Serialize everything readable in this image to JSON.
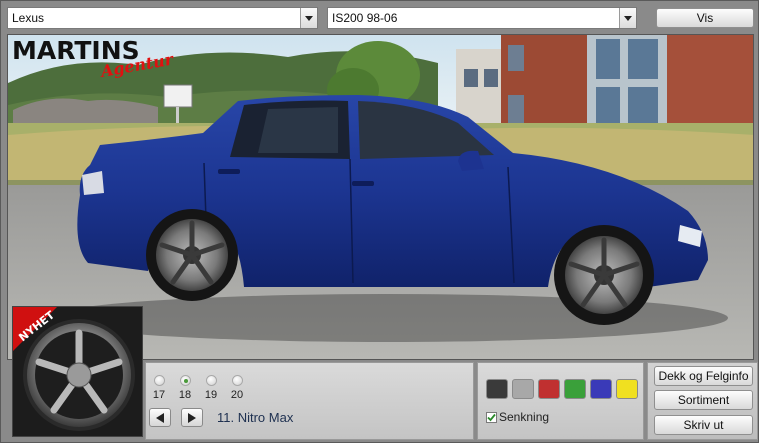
{
  "selectors": {
    "make": "Lexus",
    "model": "IS200 98-06"
  },
  "toolbar": {
    "show_label": "Vis"
  },
  "banner": {
    "brand": "MARTINS",
    "tagline": "Agentur",
    "badge": "NYHET"
  },
  "wheel": {
    "sizes": [
      {
        "label": "17",
        "selected": false
      },
      {
        "label": "18",
        "selected": true
      },
      {
        "label": "19",
        "selected": false
      },
      {
        "label": "20",
        "selected": false
      }
    ],
    "name": "11. Nitro Max"
  },
  "colors": {
    "swatches": [
      {
        "name": "black",
        "hex": "#3a3a3a"
      },
      {
        "name": "grey",
        "hex": "#a8a8a8"
      },
      {
        "name": "red",
        "hex": "#c03030"
      },
      {
        "name": "green",
        "hex": "#3aa03a"
      },
      {
        "name": "blue",
        "hex": "#3a3ab8"
      },
      {
        "name": "yellow",
        "hex": "#f0e020"
      }
    ],
    "lowering_label": "Senkning",
    "lowering_checked": true
  },
  "buttons": {
    "tire_info": "Dekk og Felginfo",
    "assortment": "Sortiment",
    "print": "Skriv ut"
  },
  "icons": {
    "dropdown": "chevron-down-icon",
    "prev": "triangle-left-icon",
    "next": "triangle-right-icon",
    "check": "check-icon"
  }
}
